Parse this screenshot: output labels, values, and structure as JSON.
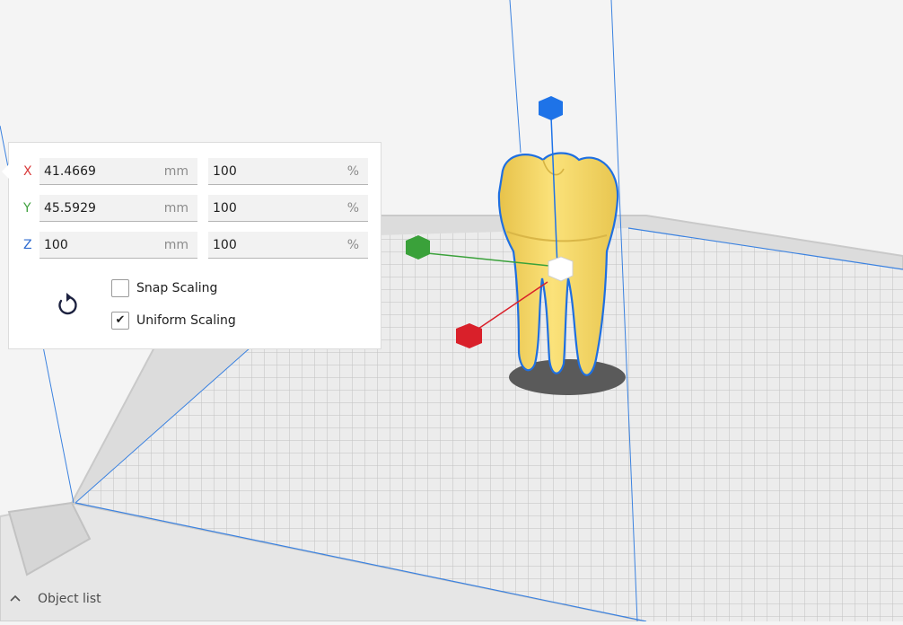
{
  "scale_tool": {
    "rows": [
      {
        "axis": "X",
        "axis_color": "#d93b3b",
        "mm_value": "41.4669",
        "mm_unit": "mm",
        "pct_value": "100",
        "pct_unit": "%"
      },
      {
        "axis": "Y",
        "axis_color": "#40a13f",
        "mm_value": "45.5929",
        "mm_unit": "mm",
        "pct_value": "100",
        "pct_unit": "%"
      },
      {
        "axis": "Z",
        "axis_color": "#2f6cd0",
        "mm_value": "100",
        "mm_unit": "mm",
        "pct_value": "100",
        "pct_unit": "%"
      }
    ],
    "snap_scaling": {
      "label": "Snap Scaling",
      "checked": false
    },
    "uniform_scaling": {
      "label": "Uniform Scaling",
      "checked": true
    },
    "reset_icon": "reset-rotate-icon"
  },
  "object_list": {
    "label": "Object list",
    "icon": "chevron-up-icon"
  },
  "colors": {
    "selection_outline": "#1f6fe0",
    "model_fill": "#f6dc6b",
    "handle_x": "#d9202a",
    "handle_y": "#3aa13a",
    "handle_z": "#1e73e8"
  }
}
